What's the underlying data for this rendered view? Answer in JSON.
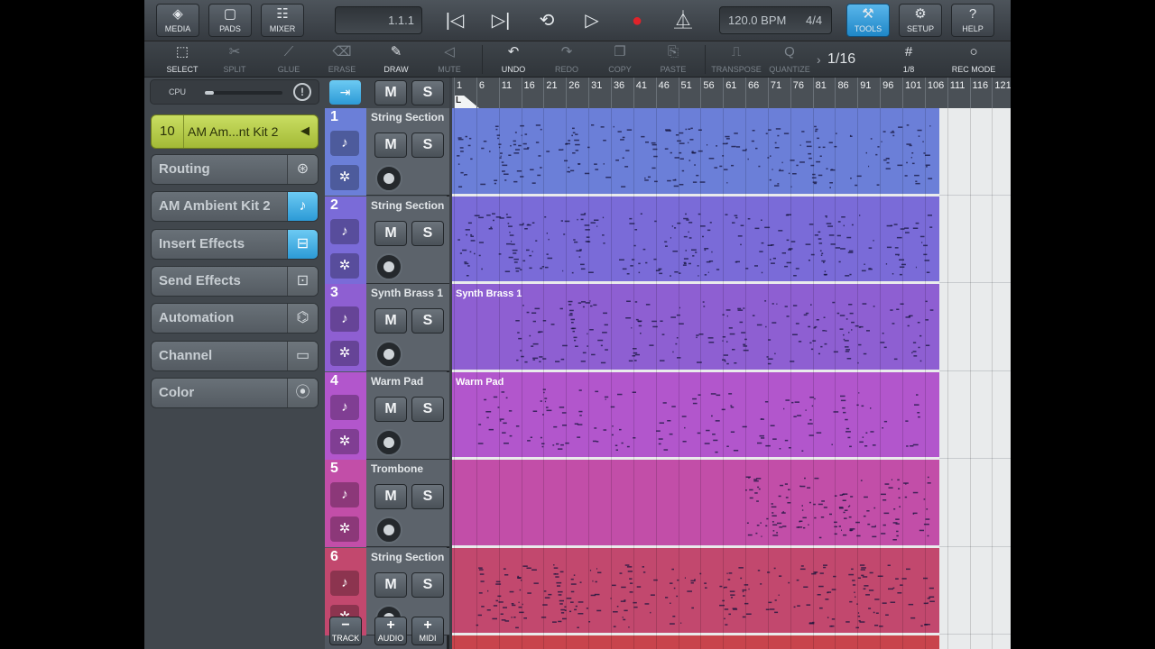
{
  "topbar": {
    "media_label": "MEDIA",
    "pads_label": "PADS",
    "mixer_label": "MIXER",
    "position": "1.1.1",
    "tempo": "120.0 BPM",
    "signature": "4/4",
    "tools_label": "TOOLS",
    "setup_label": "SETUP",
    "help_label": "HELP"
  },
  "toolbar": {
    "select": "SELECT",
    "split": "SPLIT",
    "glue": "GLUE",
    "erase": "ERASE",
    "draw": "DRAW",
    "mute": "MUTE",
    "undo": "UNDO",
    "redo": "REDO",
    "copy": "COPY",
    "paste": "PASTE",
    "transpose": "TRANSPOSE",
    "quantize": "QUANTIZE",
    "quantize_value": "1/16",
    "grid_label": "1/8",
    "rec_mode": "REC MODE"
  },
  "inspector": {
    "cpu_label": "CPU",
    "cpu_load": 0.12,
    "track_number": "10",
    "track_name": "AM Am...nt Kit 2",
    "items": [
      {
        "label": "Routing",
        "icon": "routing-icon"
      },
      {
        "label": "AM Ambient Kit 2",
        "icon": "instrument-icon"
      },
      {
        "label": "Insert Effects",
        "icon": "insert-effects-icon"
      },
      {
        "label": "Send Effects",
        "icon": "send-effects-icon"
      },
      {
        "label": "Automation",
        "icon": "automation-icon"
      },
      {
        "label": "Channel",
        "icon": "channel-icon"
      },
      {
        "label": "Color",
        "icon": "color-icon"
      }
    ]
  },
  "header_buttons": {
    "mute": "M",
    "solo": "S"
  },
  "tracks": [
    {
      "number": "1",
      "name": "String Section",
      "clip_name": "",
      "color": "#6b7fd8"
    },
    {
      "number": "2",
      "name": "String Section",
      "clip_name": "",
      "color": "#7a6bd8"
    },
    {
      "number": "3",
      "name": "Synth Brass 1",
      "clip_name": "Synth Brass 1",
      "color": "#8e5fd2"
    },
    {
      "number": "4",
      "name": "Warm Pad",
      "clip_name": "Warm Pad",
      "color": "#b256cc"
    },
    {
      "number": "5",
      "name": "Trombone",
      "clip_name": "",
      "color": "#c24ea8"
    },
    {
      "number": "6",
      "name": "String Section",
      "clip_name": "",
      "color": "#c2486e"
    }
  ],
  "ruler": {
    "bars": [
      "1",
      "6",
      "11",
      "16",
      "21",
      "26",
      "31",
      "36",
      "41",
      "46",
      "51",
      "56",
      "61",
      "66",
      "71",
      "76",
      "81",
      "86",
      "91",
      "96",
      "101",
      "106",
      "111",
      "116",
      "121"
    ],
    "locator_label": "L"
  },
  "bottom": {
    "track": "TRACK",
    "audio": "AUDIO",
    "midi": "MIDI"
  }
}
